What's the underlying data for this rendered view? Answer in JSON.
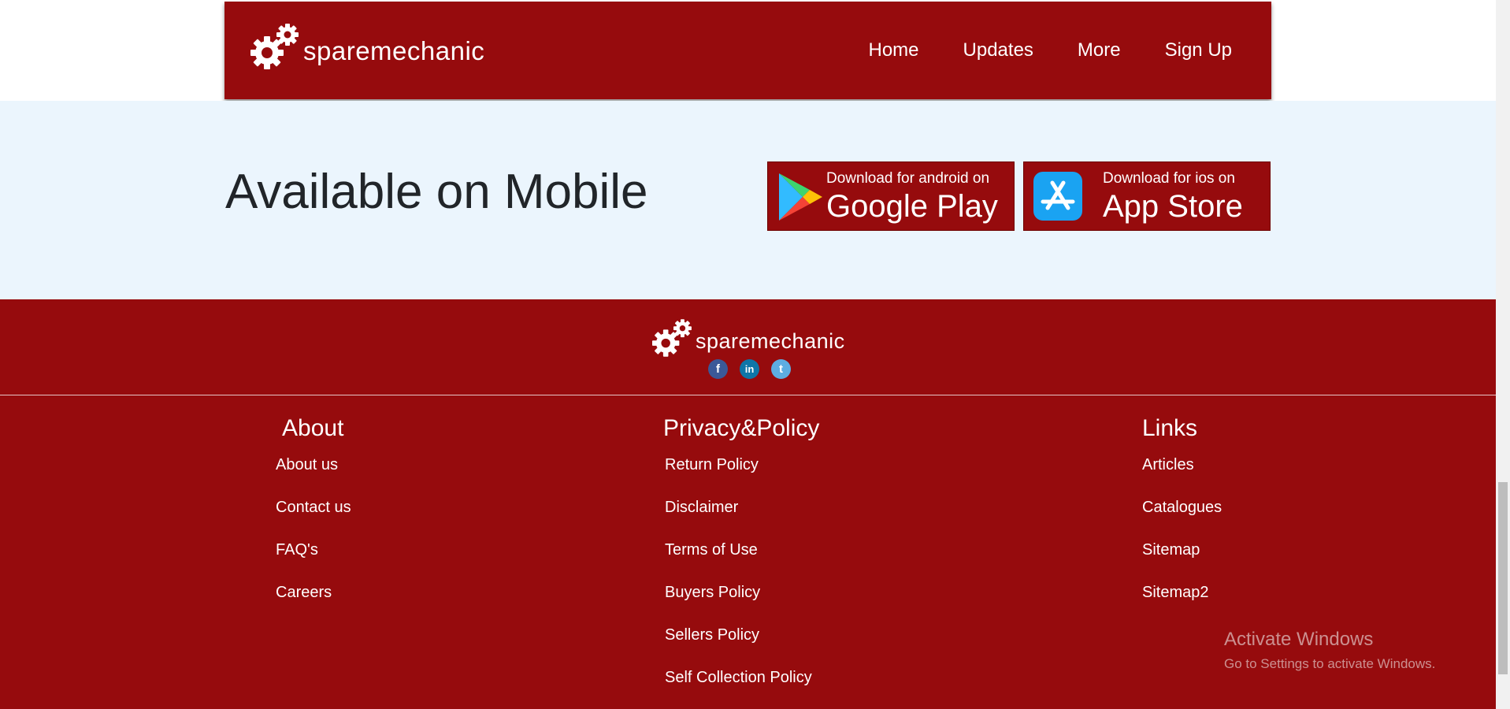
{
  "brand": {
    "name": "sparemechanic"
  },
  "header": {
    "nav": [
      {
        "label": "Home"
      },
      {
        "label": "Updates"
      },
      {
        "label": "More"
      },
      {
        "label": "Sign Up"
      }
    ]
  },
  "mobile": {
    "title": "Available on Mobile",
    "google_play": {
      "small": "Download for android on",
      "big": "Google Play"
    },
    "app_store": {
      "small": "Download for ios on",
      "big": "App Store"
    }
  },
  "footer": {
    "socials": [
      {
        "icon": "facebook-icon",
        "glyph": "f"
      },
      {
        "icon": "linkedin-icon",
        "glyph": "in"
      },
      {
        "icon": "twitter-icon",
        "glyph": "t"
      }
    ],
    "about": {
      "heading": "About",
      "links": [
        "About us",
        "Contact us",
        "FAQ's",
        "Careers"
      ]
    },
    "privacy": {
      "heading": "Privacy&Policy",
      "links": [
        "Return Policy",
        "Disclaimer",
        "Terms of Use",
        "Buyers Policy",
        "Sellers Policy",
        "Self Collection Policy"
      ]
    },
    "links": {
      "heading": "Links",
      "links": [
        "Articles",
        "Catalogues",
        "Sitemap",
        "Sitemap2"
      ]
    }
  },
  "watermark": {
    "title": "Activate Windows",
    "subtitle": "Go to Settings to activate Windows."
  },
  "colors": {
    "brand_red": "#960b0d",
    "mobile_band": "#ebf5fd",
    "title_text": "#212529"
  }
}
